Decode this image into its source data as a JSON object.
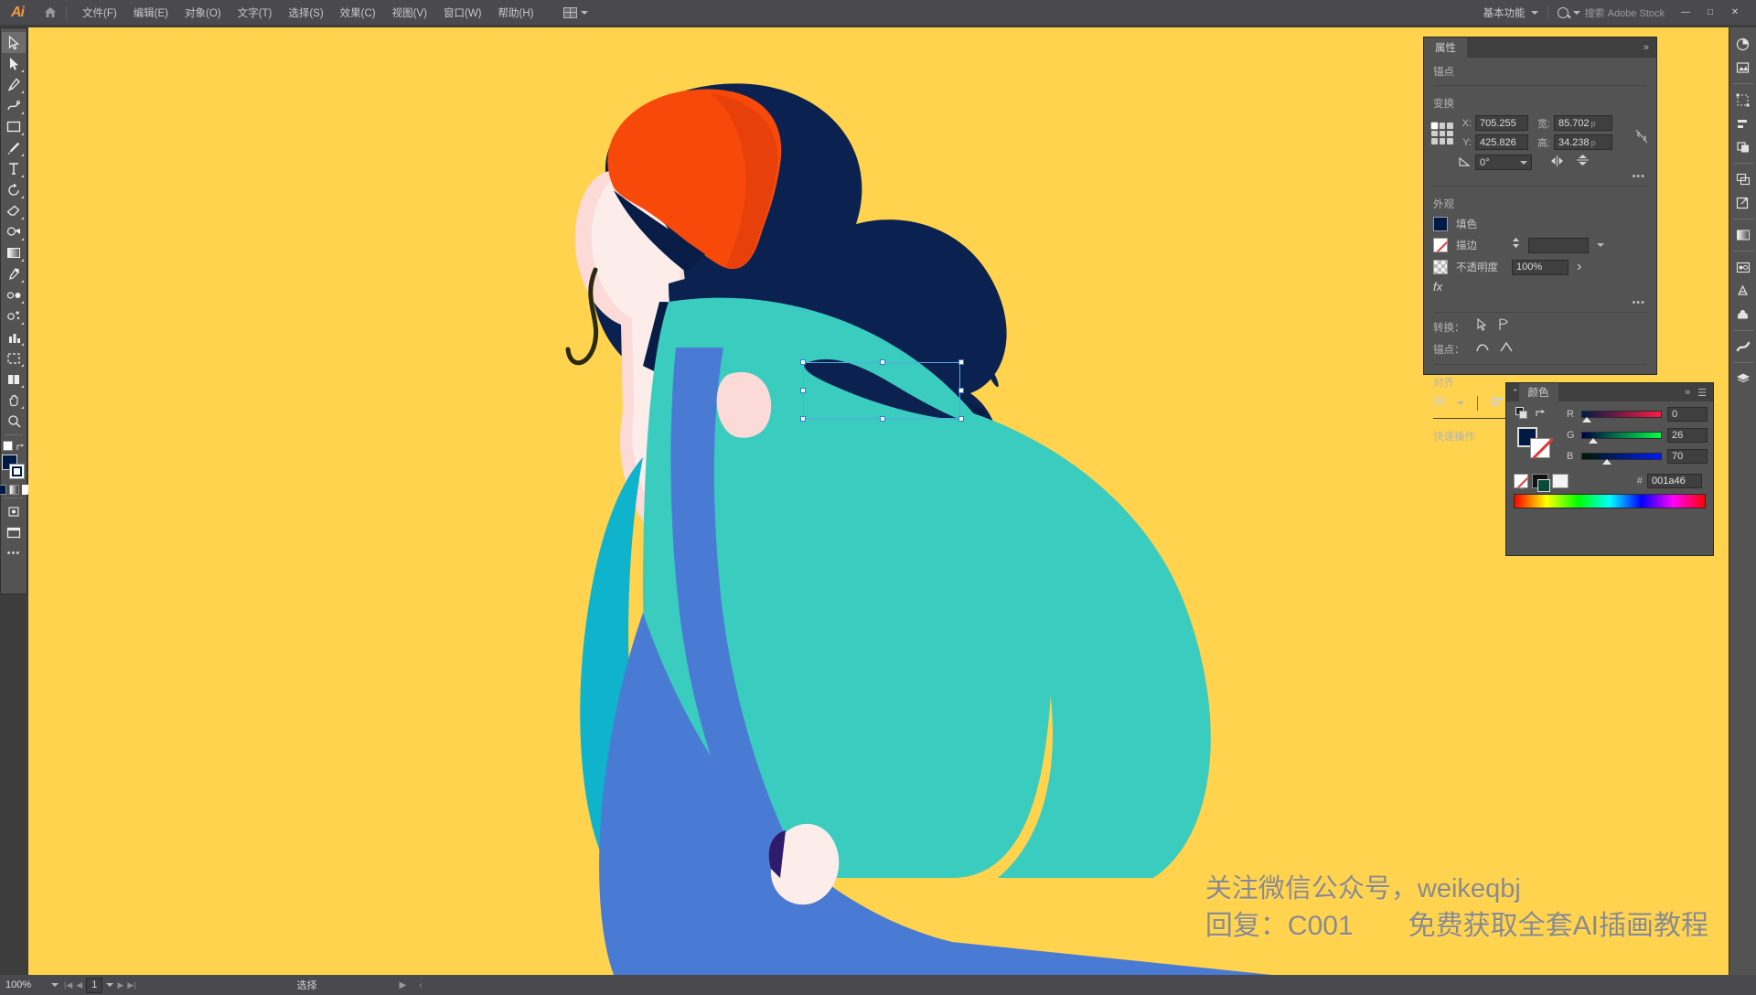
{
  "app": {
    "name": "Adobe Illustrator",
    "logo_text": "Ai"
  },
  "menubar": {
    "home_icon": "home-icon",
    "items": [
      {
        "label": "文件(F)"
      },
      {
        "label": "编辑(E)"
      },
      {
        "label": "对象(O)"
      },
      {
        "label": "文字(T)"
      },
      {
        "label": "选择(S)"
      },
      {
        "label": "效果(C)"
      },
      {
        "label": "视图(V)"
      },
      {
        "label": "窗口(W)"
      },
      {
        "label": "帮助(H)"
      }
    ],
    "arrange_documents": "arrange-documents-icon",
    "workspace": "基本功能",
    "search_placeholder": "搜索 Adobe Stock",
    "window_controls": [
      "—",
      "□",
      "✕"
    ]
  },
  "toolbar": {
    "tools": [
      {
        "name": "selection-tool",
        "active": true
      },
      {
        "name": "direct-selection-tool",
        "active": false
      },
      {
        "name": "magic-wand-tool",
        "active": false
      },
      {
        "name": "lasso-tool",
        "active": false
      },
      {
        "name": "pen-tool",
        "active": false
      },
      {
        "name": "curvature-tool",
        "active": false
      },
      {
        "name": "type-tool",
        "active": false
      },
      {
        "name": "line-segment-tool",
        "active": false
      },
      {
        "name": "rectangle-tool",
        "active": false
      },
      {
        "name": "paintbrush-tool",
        "active": false
      },
      {
        "name": "shaper-tool",
        "active": false
      },
      {
        "name": "pencil-tool",
        "active": false
      },
      {
        "name": "eraser-tool",
        "active": false
      },
      {
        "name": "rotate-tool",
        "active": false
      },
      {
        "name": "scale-tool",
        "active": false
      },
      {
        "name": "width-tool",
        "active": false
      },
      {
        "name": "free-transform-tool",
        "active": false
      },
      {
        "name": "shape-builder-tool",
        "active": false
      },
      {
        "name": "perspective-grid-tool",
        "active": false
      },
      {
        "name": "mesh-tool",
        "active": false
      },
      {
        "name": "gradient-tool",
        "active": false
      },
      {
        "name": "eyedropper-tool",
        "active": false
      },
      {
        "name": "blend-tool",
        "active": false
      },
      {
        "name": "symbol-sprayer-tool",
        "active": false
      },
      {
        "name": "column-graph-tool",
        "active": false
      },
      {
        "name": "artboard-tool",
        "active": false
      },
      {
        "name": "slice-tool",
        "active": false
      },
      {
        "name": "hand-tool",
        "active": false
      },
      {
        "name": "zoom-tool",
        "active": false
      }
    ],
    "fill_color": "#001a46",
    "stroke_color": "#ffffff",
    "more_label": "•••"
  },
  "properties_panel": {
    "tab_label": "属性",
    "collapse_icon": "double-chevron-right-icon",
    "anchor_section": "锚点",
    "transform_section": "变换",
    "fields": {
      "x_label": "X:",
      "x_value": "705.255",
      "y_label": "Y:",
      "y_value": "425.826",
      "w_label": "宽:",
      "w_value": "85.702",
      "w_unit": "p",
      "h_label": "高:",
      "h_value": "34.238",
      "h_unit": "p",
      "angle_label": "angle-icon",
      "angle_value": "0°",
      "lock_ratio_icon": "link-broken-icon",
      "flip_h_icon": "flip-horizontal-icon",
      "flip_v_icon": "flip-vertical-icon",
      "more_options": "•••"
    },
    "appearance_section": "外观",
    "appearance": {
      "fill_label": "填色",
      "fill_color": "#001a46",
      "stroke_label": "描边",
      "stroke_color": "none",
      "stroke_weight": "",
      "opacity_label": "不透明度",
      "opacity_value": "100%",
      "fx_label": "fx",
      "more_options": "•••"
    },
    "convert_section": "转换：",
    "anchor_row_label": "锚点：",
    "align_section": "对齐",
    "quick_actions_section": "快速操作"
  },
  "color_panel": {
    "tab_label": "颜色",
    "collapse_icon": "double-chevron-right-icon",
    "menu_icon": "panel-menu-icon",
    "fill_color": "#001a46",
    "stroke_color": "none",
    "sliders": [
      {
        "label": "R",
        "value": "0"
      },
      {
        "label": "G",
        "value": "26"
      },
      {
        "label": "B",
        "value": "70"
      }
    ],
    "hex_symbol": "#",
    "hex_value": "001a46",
    "swatch_none": "none-swatch",
    "swatch_black": "black-swatch",
    "swatch_white": "white-swatch"
  },
  "right_dock": {
    "panels": [
      {
        "name": "color-guide-panel-icon"
      },
      {
        "name": "image-trace-panel-icon"
      },
      {
        "name": "transform-panel-icon"
      },
      {
        "name": "align-panel-icon"
      },
      {
        "name": "pathfinder-panel-icon"
      },
      {
        "name": "artboards-panel-icon"
      },
      {
        "name": "export-panel-icon"
      },
      {
        "name": "gradient-panel-icon"
      },
      {
        "name": "appearance-panel-icon"
      },
      {
        "name": "graphic-styles-panel-icon"
      },
      {
        "name": "symbols-panel-icon"
      },
      {
        "name": "brushes-panel-icon"
      },
      {
        "name": "layers-panel-icon"
      }
    ]
  },
  "statusbar": {
    "zoom_level": "100%",
    "artboard_nav_first": "|◀",
    "artboard_nav_prev": "◀",
    "artboard_number": "1",
    "artboard_nav_next": "▶",
    "artboard_nav_last": "▶|",
    "current_tool": "选择",
    "play_icon": "play-icon",
    "prev_icon": "prev-icon"
  },
  "artboard": {
    "background_color": "#FFD34E",
    "watermark_line1": "关注微信公众号，weikeqbj",
    "watermark_line2": "回复：C001　　免费获取全套AI插画教程",
    "illustration_name": "woman-with-orange-beanie-illustration",
    "palette": {
      "background": "#FFD34E",
      "hat": "#F74A0A",
      "hat_shadow": "#E8400A",
      "hair": "#0B2251",
      "hair_dark": "#081C45",
      "skin": "#FBDAD8",
      "skin_light": "#FDEDEA",
      "coat_teal": "#3BCCC0",
      "coat_cyan": "#0FB4CC",
      "strap_blue": "#4A7BD4",
      "skirt_blue": "#4A7BD4"
    },
    "selection": {
      "shape_name": "eyebrow-teardrop-shape",
      "fill": "#0B2251",
      "handle_color": "#2d7fd0"
    }
  }
}
